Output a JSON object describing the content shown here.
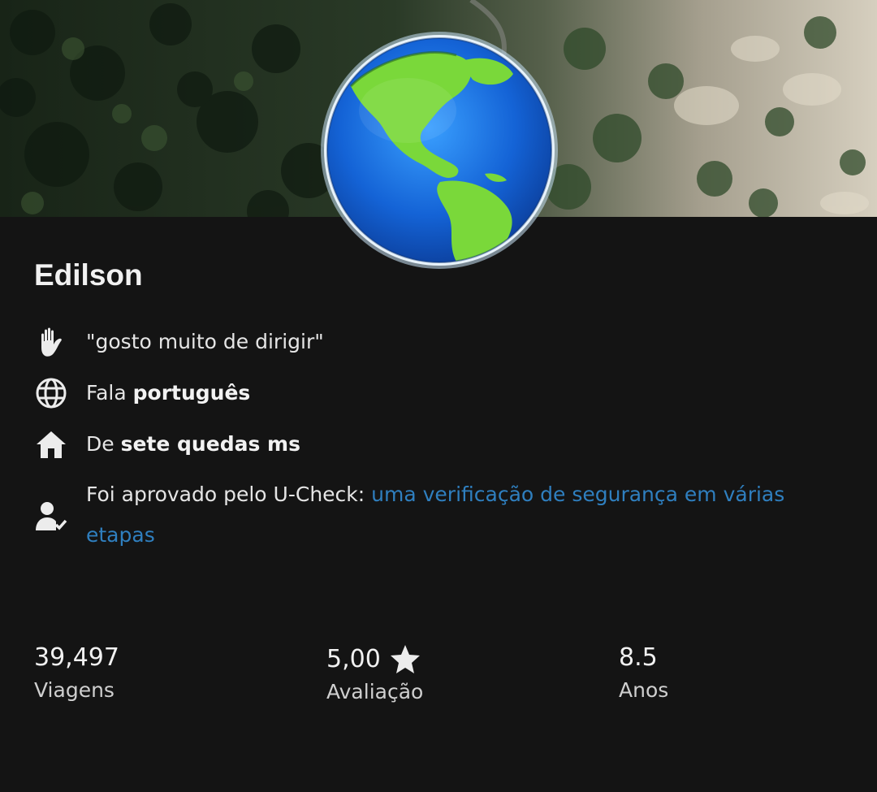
{
  "profile": {
    "name": "Edilson",
    "quote": "\"gosto muito de dirigir\"",
    "language": {
      "prefix": "Fala",
      "value": "português"
    },
    "hometown": {
      "prefix": "De",
      "value": "sete quedas ms"
    },
    "verification": {
      "prefix": "Foi aprovado pelo U-Check:",
      "link": "uma verificação de segurança em várias etapas"
    }
  },
  "stats": [
    {
      "value": "39,497",
      "label": "Viagens"
    },
    {
      "value": "5,00",
      "label": "Avaliação",
      "icon": "star-icon"
    },
    {
      "value": "8.5",
      "label": "Anos"
    }
  ],
  "icons": {
    "quote": "wave-hand-icon",
    "language": "globe-icon",
    "hometown": "home-icon",
    "verification": "user-check-icon",
    "avatar": "earth-globe-avatar"
  },
  "colors": {
    "background": "#141414",
    "link": "#2f7fbf",
    "text": "#e9e9e9"
  }
}
